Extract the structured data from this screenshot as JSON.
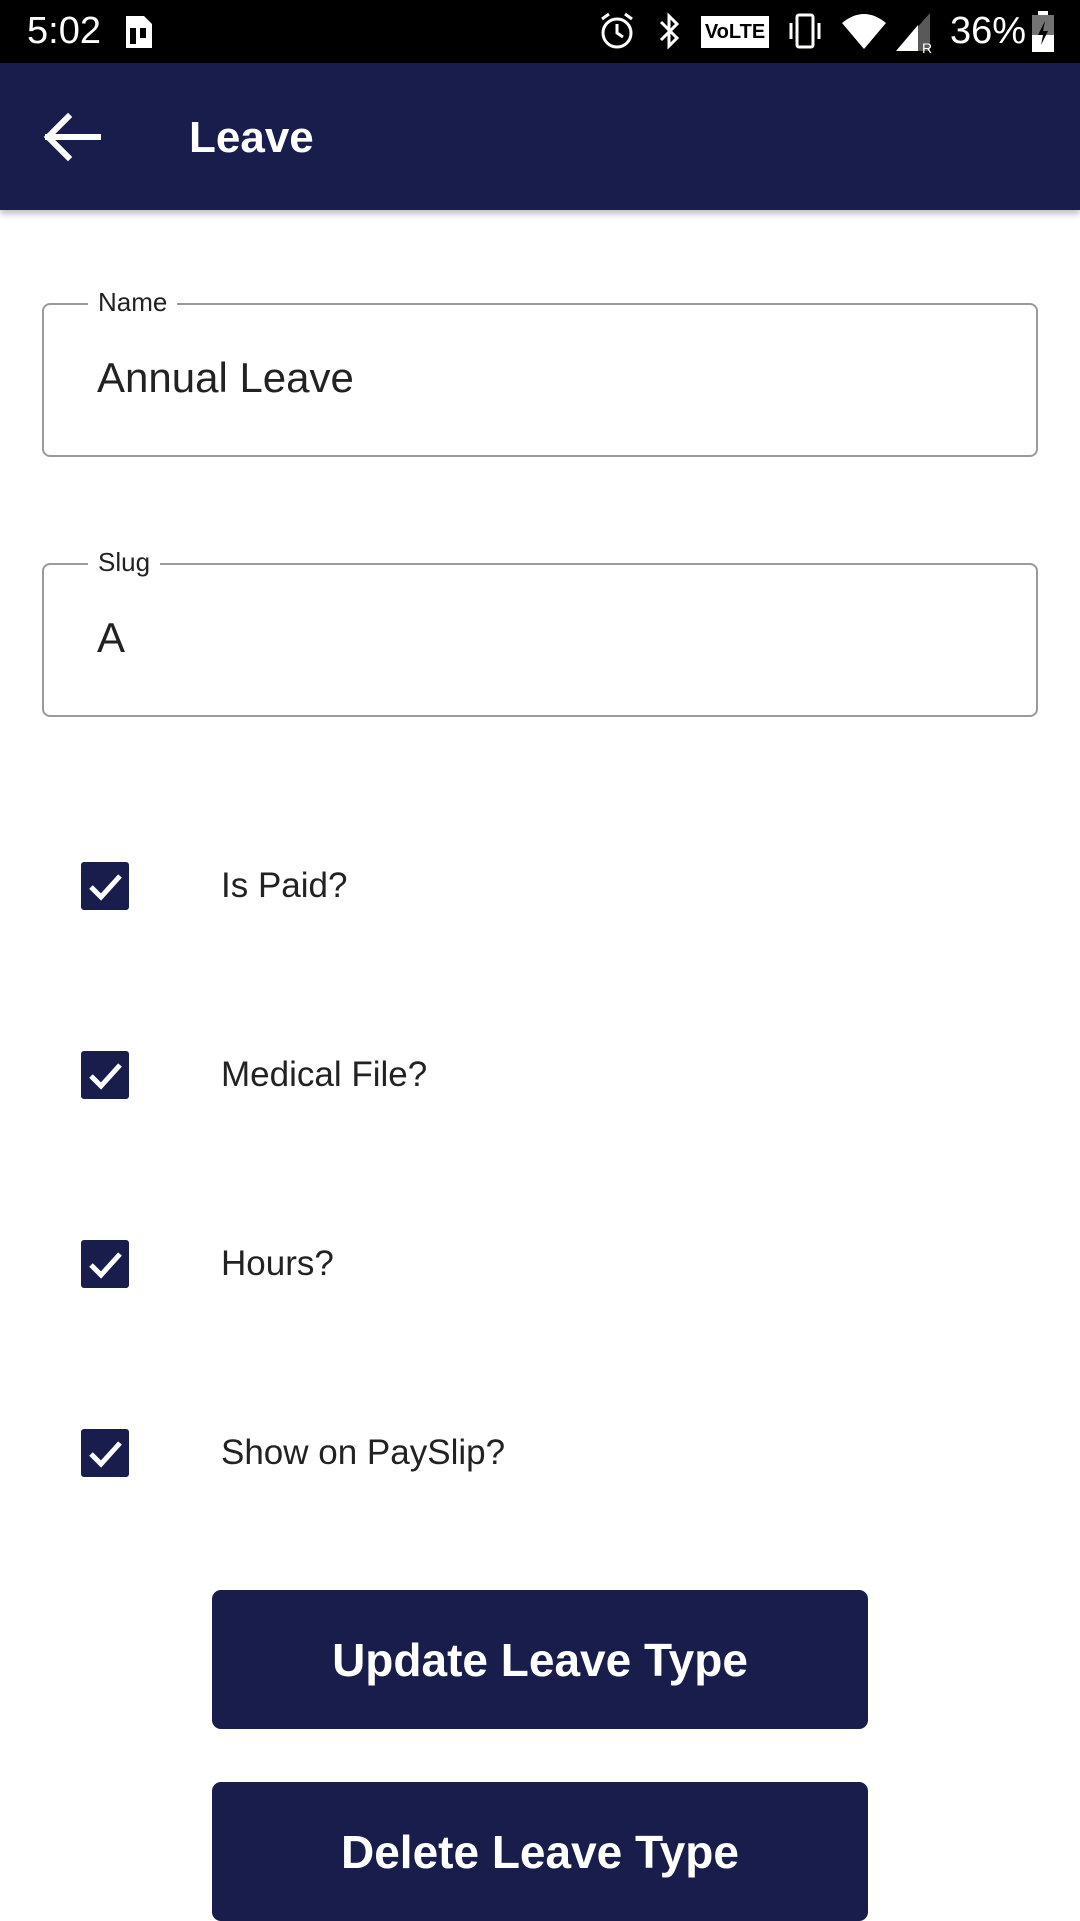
{
  "status_bar": {
    "time": "5:02",
    "volte": "VoLTE",
    "battery": "36%"
  },
  "app_bar": {
    "title": "Leave",
    "back_icon": "arrow-left-icon"
  },
  "form": {
    "name_label": "Name",
    "name_value": "Annual Leave",
    "slug_label": "Slug",
    "slug_value": "A"
  },
  "checkboxes": [
    {
      "label": "Is Paid?",
      "checked": true
    },
    {
      "label": "Medical File?",
      "checked": true
    },
    {
      "label": "Hours?",
      "checked": true
    },
    {
      "label": "Show on PaySlip?",
      "checked": true
    }
  ],
  "buttons": {
    "update": "Update Leave Type",
    "delete": "Delete Leave Type"
  },
  "colors": {
    "primary": "#181d4c",
    "status_bar": "#000000",
    "field_border": "#9a9a9a"
  }
}
